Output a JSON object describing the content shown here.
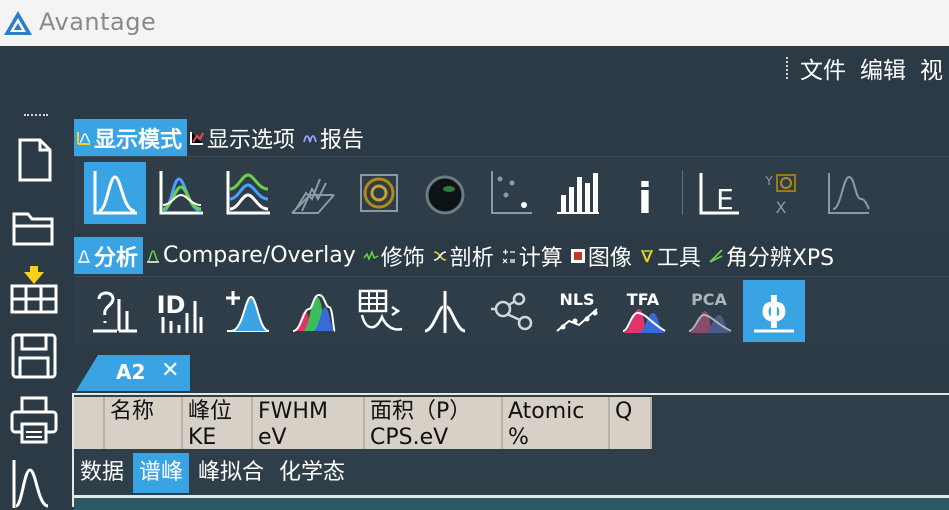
{
  "app": {
    "title": "Avantage"
  },
  "menu": [
    "文件",
    "编辑",
    "视"
  ],
  "display_tabs": [
    {
      "label": "显示模式",
      "active": true,
      "icon": "display-mode-icon"
    },
    {
      "label": "显示选项",
      "active": false,
      "icon": "display-options-icon"
    },
    {
      "label": "报告",
      "active": false,
      "icon": "report-icon"
    }
  ],
  "analysis_tabs": [
    {
      "label": "分析",
      "active": true,
      "icon": "analysis-icon"
    },
    {
      "label": "Compare/Overlay",
      "active": false,
      "icon": "compare-overlay-icon"
    },
    {
      "label": "修饰",
      "active": false,
      "icon": "modify-icon"
    },
    {
      "label": "剖析",
      "active": false,
      "icon": "profile-icon"
    },
    {
      "label": "计算",
      "active": false,
      "icon": "calculate-icon"
    },
    {
      "label": "图像",
      "active": false,
      "icon": "image-icon"
    },
    {
      "label": "工具",
      "active": false,
      "icon": "tools-icon"
    },
    {
      "label": "角分辨XPS",
      "active": false,
      "icon": "arxps-icon"
    }
  ],
  "tool_labels": {
    "nls": "NLS",
    "tfa": "TFA",
    "pca": "PCA",
    "info": "i",
    "le": "E",
    "yx_y": "Y",
    "yx_x": "X",
    "id": "ID",
    "phi": "ϕ"
  },
  "document_tab": {
    "label": "A2",
    "close": "✕"
  },
  "peak_table": {
    "columns": [
      "名称",
      "峰位\nKE",
      "FWHM\neV",
      "面积（P）\nCPS.eV",
      "Atomic\n%",
      "Q"
    ]
  },
  "bottom_tabs": [
    {
      "label": "数据",
      "active": false
    },
    {
      "label": "谱峰",
      "active": true
    },
    {
      "label": "峰拟合",
      "active": false
    },
    {
      "label": "化学态",
      "active": false
    }
  ],
  "colors": {
    "accent": "#3aa3e3",
    "background": "#2b3a44",
    "titlebar": "#f4f4f4",
    "table_header": "#d6d0c6"
  }
}
